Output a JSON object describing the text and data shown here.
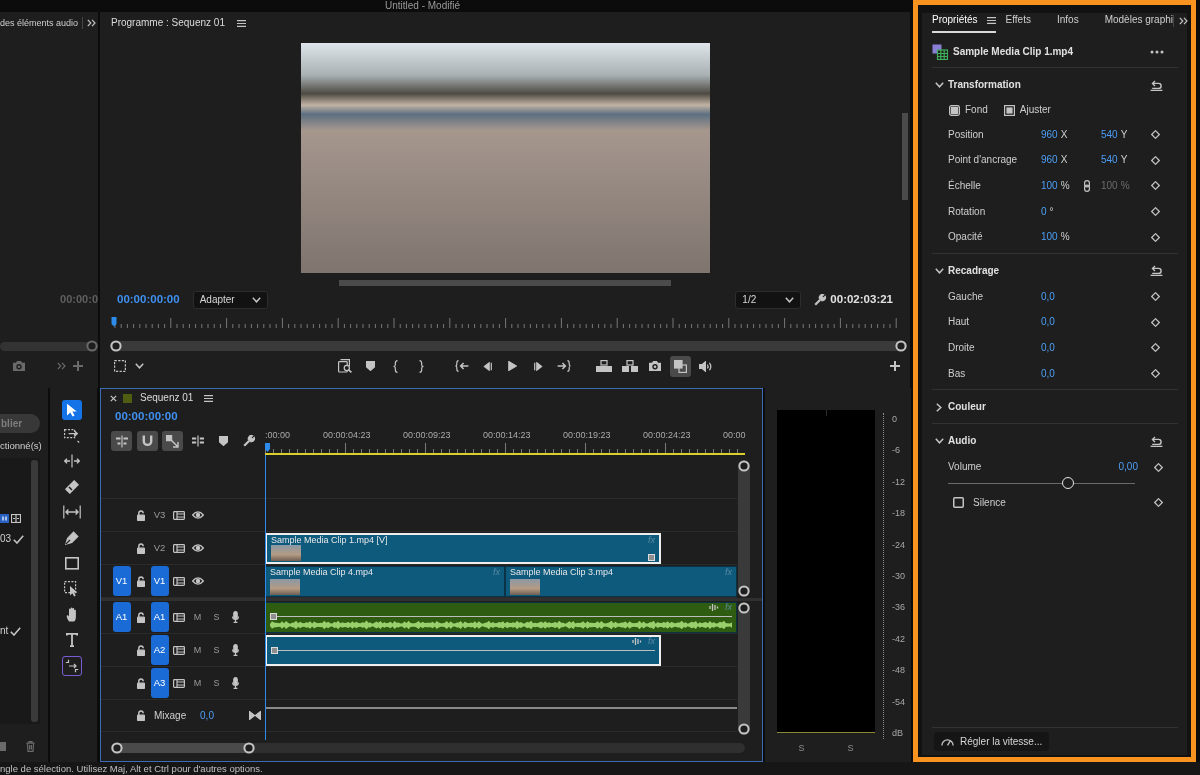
{
  "window": {
    "title": "Untitled - Modifié"
  },
  "audio_mixer_panel": {
    "tab": "des éléments audio",
    "timecode": "00:00:0"
  },
  "program_monitor": {
    "title": "Programme : Sequenz 01",
    "timecode": "00:00:00:00",
    "zoom": "Adapter",
    "resolution": "1/2",
    "duration": "00:02:03:21",
    "buttons": [
      {
        "kind": "zoom-frame",
        "on": false
      },
      {
        "kind": "marker",
        "on": false
      },
      {
        "kind": "mark-in",
        "on": false
      },
      {
        "kind": "mark-out",
        "on": false
      },
      {
        "kind": "go-to-in",
        "on": false
      },
      {
        "kind": "step-back",
        "on": false
      },
      {
        "kind": "play",
        "on": false
      },
      {
        "kind": "step-forward",
        "on": false
      },
      {
        "kind": "go-to-out",
        "on": false
      },
      {
        "kind": "lift",
        "on": false
      },
      {
        "kind": "extract",
        "on": false
      },
      {
        "kind": "camera",
        "on": false
      },
      {
        "kind": "compare",
        "on": true
      },
      {
        "kind": "speaker",
        "on": false
      }
    ]
  },
  "project_panel": {
    "button": "blier",
    "label": "ctionné(s)",
    "items": [
      {
        "label": "03",
        "checked": true
      },
      {
        "label": "nt",
        "checked": true
      }
    ]
  },
  "tools": [
    {
      "kind": "selection",
      "selected": true
    },
    {
      "kind": "track-select",
      "selected": false
    },
    {
      "kind": "ripple",
      "selected": false
    },
    {
      "kind": "razor",
      "selected": false
    },
    {
      "kind": "slip",
      "selected": false
    },
    {
      "kind": "pen",
      "selected": false
    },
    {
      "kind": "rectangle",
      "selected": false
    },
    {
      "kind": "remix",
      "selected": false
    },
    {
      "kind": "hand",
      "selected": false
    },
    {
      "kind": "type",
      "selected": false
    },
    {
      "kind": "extend",
      "selected": false
    }
  ],
  "timeline": {
    "title": "Sequenz 01",
    "timecode": "00:00:00:00",
    "toolbar": [
      {
        "kind": "nest",
        "on": true
      },
      {
        "kind": "snap",
        "on": true
      },
      {
        "kind": "linked",
        "on": true
      },
      {
        "kind": "add-edit",
        "on": false
      },
      {
        "kind": "marker",
        "on": false
      },
      {
        "kind": "settings",
        "on": false
      }
    ],
    "ruler": [
      ":00:00",
      "00:00:04:23",
      "00:00:09:23",
      "00:00:14:23",
      "00:00:19:23",
      "00:00:24:23",
      "00:00"
    ],
    "tracks": [
      {
        "kind": "video",
        "name": "V3",
        "targeted": false
      },
      {
        "kind": "video",
        "name": "V2",
        "targeted": false,
        "clips": [
          {
            "name": "Sample Media Clip 1.mp4 [V]",
            "badge": "fx",
            "selected": true,
            "color": "#0e5a7d"
          }
        ]
      },
      {
        "kind": "video",
        "name": "V1",
        "source": "V1",
        "targeted": true,
        "clips": [
          {
            "name": "Sample Media Clip 4.mp4",
            "badge": "fx",
            "selected": false,
            "color": "#0e5a7d"
          },
          {
            "name": "Sample Media Clip 3.mp4",
            "badge": "fx",
            "selected": false,
            "color": "#0e5a7d"
          }
        ]
      },
      {
        "kind": "audio",
        "name": "A1",
        "source": "A1",
        "targeted": true,
        "mute": "M",
        "solo": "S",
        "clips": [
          {
            "badge": "fx",
            "waveform": true,
            "selected": false,
            "color": "#2e5c10"
          }
        ]
      },
      {
        "kind": "audio",
        "name": "A2",
        "targeted": true,
        "mute": "M",
        "solo": "S",
        "clips": [
          {
            "badge": "fx",
            "waveform": false,
            "selected": true,
            "color": "#0e5a7d"
          }
        ]
      },
      {
        "kind": "audio",
        "name": "A3",
        "targeted": true,
        "mute": "M",
        "solo": "S"
      },
      {
        "kind": "mix",
        "name": "Mixage",
        "value": "0,0"
      }
    ]
  },
  "audio_meter": {
    "scale": [
      "0",
      "-6",
      "-12",
      "-18",
      "-24",
      "-30",
      "-36",
      "-42",
      "-48",
      "-54",
      "dB"
    ],
    "solo": [
      "S",
      "S"
    ]
  },
  "properties": {
    "highlighted": true,
    "tabs": [
      {
        "label": "Propriétés",
        "selected": true
      },
      {
        "label": "Effets",
        "selected": false
      },
      {
        "label": "Infos",
        "selected": false
      },
      {
        "label": "Modèles graphi",
        "selected": false
      }
    ],
    "clip": "Sample Media Clip 1.mp4",
    "sections": [
      {
        "title": "Transformation",
        "expanded": true,
        "reset": true,
        "modes": [
          "Fond",
          "Ajuster"
        ],
        "rows": [
          {
            "kind": "pair",
            "label": "Position",
            "value": "960",
            "unit": "X",
            "value2": "540",
            "unit2": "Y"
          },
          {
            "kind": "pair",
            "label": "Point d'ancrage",
            "value": "960",
            "unit": "X",
            "value2": "540",
            "unit2": "Y"
          },
          {
            "kind": "scale",
            "label": "Échelle",
            "value": "100",
            "unit": "%",
            "value2": "100",
            "unit2": "%"
          },
          {
            "kind": "single",
            "label": "Rotation",
            "value": "0",
            "unit": "°"
          },
          {
            "kind": "single",
            "label": "Opacité",
            "value": "100",
            "unit": "%"
          }
        ]
      },
      {
        "title": "Recadrage",
        "expanded": true,
        "reset": true,
        "rows": [
          {
            "kind": "single",
            "label": "Gauche",
            "value": "0,0"
          },
          {
            "kind": "single",
            "label": "Haut",
            "value": "0,0"
          },
          {
            "kind": "single",
            "label": "Droite",
            "value": "0,0"
          },
          {
            "kind": "single",
            "label": "Bas",
            "value": "0,0"
          }
        ]
      },
      {
        "title": "Couleur",
        "expanded": false,
        "reset": false
      },
      {
        "title": "Audio",
        "expanded": true,
        "reset": true,
        "rows": [
          {
            "kind": "slider",
            "label": "Volume",
            "value": "0,00",
            "level": 0.64
          },
          {
            "kind": "checkbox",
            "label": "Silence",
            "checked": false
          }
        ]
      }
    ],
    "speed_button": "Régler la vitesse..."
  },
  "status_bar": "ngle de sélection. Utilisez Maj, Alt et Ctrl pour d'autres options."
}
